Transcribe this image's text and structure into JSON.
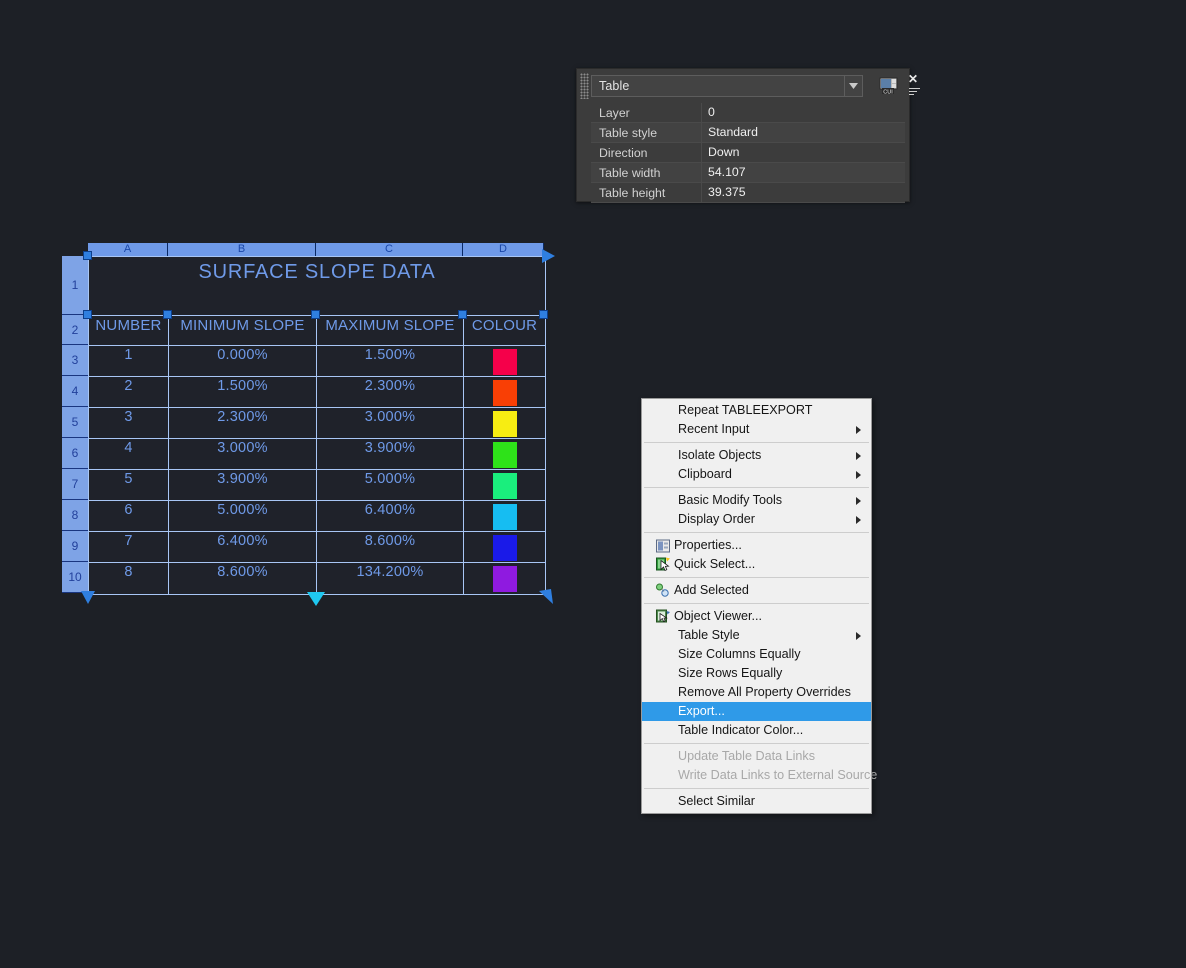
{
  "app": {
    "background_color": "#1d2026",
    "accent_selection_color": "#2f9ae8",
    "grip_color": "#2f7fe0",
    "table_line_color": "#a8c6f5",
    "table_text_color": "#6f9ae8"
  },
  "properties_palette": {
    "title": "Table",
    "combo_selected": "Table",
    "icons": {
      "gripper": "dotted-gripper-icon",
      "dropdown": "chevron-down-icon",
      "cui": "cui-toggle-icon",
      "close": "close-icon",
      "menu": "palette-menu-icon"
    },
    "rows": [
      {
        "label": "Layer",
        "value": "0"
      },
      {
        "label": "Table style",
        "value": "Standard"
      },
      {
        "label": "Direction",
        "value": "Down"
      },
      {
        "label": "Table width",
        "value": "54.107"
      },
      {
        "label": "Table height",
        "value": "39.375"
      }
    ]
  },
  "table": {
    "column_headers": [
      "A",
      "B",
      "C",
      "D"
    ],
    "row_headers": [
      "1",
      "2",
      "3",
      "4",
      "5",
      "6",
      "7",
      "8",
      "9",
      "10"
    ],
    "title": "SURFACE SLOPE DATA",
    "headers": [
      "NUMBER",
      "MINIMUM SLOPE",
      "MAXIMUM SLOPE",
      "COLOUR"
    ],
    "rows": [
      {
        "number": "1",
        "min": "0.000%",
        "max": "1.500%",
        "colour": "#f5004a"
      },
      {
        "number": "2",
        "min": "1.500%",
        "max": "2.300%",
        "colour": "#f93f05"
      },
      {
        "number": "3",
        "min": "2.300%",
        "max": "3.000%",
        "colour": "#f7ed12"
      },
      {
        "number": "4",
        "min": "3.000%",
        "max": "3.900%",
        "colour": "#2ee219"
      },
      {
        "number": "5",
        "min": "3.900%",
        "max": "5.000%",
        "colour": "#1aee7d"
      },
      {
        "number": "6",
        "min": "5.000%",
        "max": "6.400%",
        "colour": "#16bdf2"
      },
      {
        "number": "7",
        "min": "6.400%",
        "max": "8.600%",
        "colour": "#1a1ae8"
      },
      {
        "number": "8",
        "min": "8.600%",
        "max": "134.200%",
        "colour": "#8f1ae0"
      }
    ]
  },
  "context_menu": {
    "items": [
      {
        "label": "Repeat TABLEEXPORT",
        "submenu": false,
        "icon": null,
        "state": "normal"
      },
      {
        "label": "Recent Input",
        "submenu": true,
        "icon": null,
        "state": "normal"
      },
      {
        "separator": true
      },
      {
        "label": "Isolate Objects",
        "submenu": true,
        "icon": null,
        "state": "normal"
      },
      {
        "label": "Clipboard",
        "submenu": true,
        "icon": null,
        "state": "normal"
      },
      {
        "separator": true
      },
      {
        "label": "Basic Modify Tools",
        "submenu": true,
        "icon": null,
        "state": "normal"
      },
      {
        "label": "Display Order",
        "submenu": true,
        "icon": null,
        "state": "normal"
      },
      {
        "separator": true
      },
      {
        "label": "Properties...",
        "submenu": false,
        "icon": "properties-icon",
        "state": "normal"
      },
      {
        "label": "Quick Select...",
        "submenu": false,
        "icon": "quick-select-icon",
        "state": "normal"
      },
      {
        "separator": true
      },
      {
        "label": "Add Selected",
        "submenu": false,
        "icon": "add-selected-icon",
        "state": "normal"
      },
      {
        "separator": true
      },
      {
        "label": "Object Viewer...",
        "submenu": false,
        "icon": "object-viewer-icon",
        "state": "normal"
      },
      {
        "label": "Table Style",
        "submenu": true,
        "icon": null,
        "state": "normal"
      },
      {
        "label": "Size Columns Equally",
        "submenu": false,
        "icon": null,
        "state": "normal"
      },
      {
        "label": "Size Rows Equally",
        "submenu": false,
        "icon": null,
        "state": "normal"
      },
      {
        "label": "Remove All Property Overrides",
        "submenu": false,
        "icon": null,
        "state": "normal"
      },
      {
        "label": "Export...",
        "submenu": false,
        "icon": null,
        "state": "selected"
      },
      {
        "label": "Table Indicator Color...",
        "submenu": false,
        "icon": null,
        "state": "normal"
      },
      {
        "separator": true
      },
      {
        "label": "Update Table Data Links",
        "submenu": false,
        "icon": null,
        "state": "disabled"
      },
      {
        "label": "Write Data Links to External Source",
        "submenu": false,
        "icon": null,
        "state": "disabled"
      },
      {
        "separator": true
      },
      {
        "label": "Select Similar",
        "submenu": false,
        "icon": null,
        "state": "normal"
      }
    ]
  }
}
